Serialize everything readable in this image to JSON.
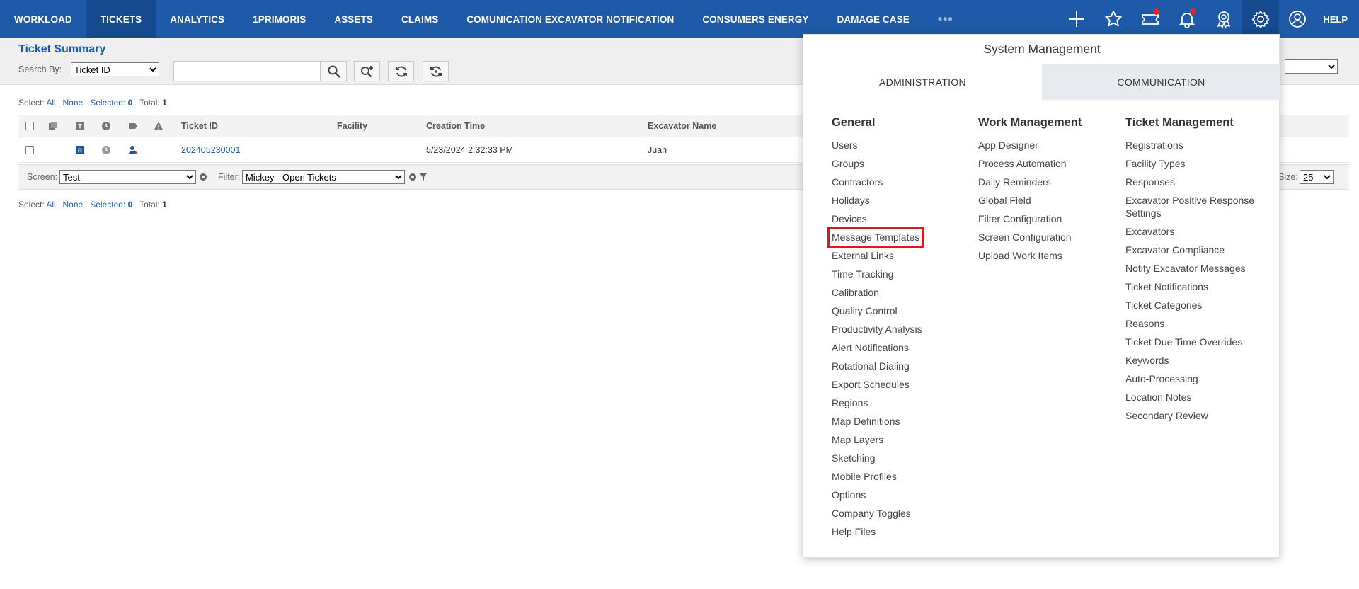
{
  "nav": {
    "items": [
      {
        "label": "WORKLOAD",
        "active": false
      },
      {
        "label": "TICKETS",
        "active": true
      },
      {
        "label": "ANALYTICS",
        "active": false
      },
      {
        "label": "1PRIMORIS",
        "active": false
      },
      {
        "label": "ASSETS",
        "active": false
      },
      {
        "label": "CLAIMS",
        "active": false
      },
      {
        "label": "COMUNICATION EXCAVATOR NOTIFICATION",
        "active": false
      },
      {
        "label": "CONSUMERS ENERGY",
        "active": false
      },
      {
        "label": "DAMAGE CASE",
        "active": false
      }
    ],
    "more": "•••",
    "icons": [
      "plus-icon",
      "star-icon",
      "ticket-icon",
      "bell-icon",
      "award-icon",
      "gear-icon",
      "user-icon"
    ],
    "help": "HELP",
    "bg_color": "#1e5aa8",
    "active_color": "#154a8f"
  },
  "header": {
    "title": "Ticket Summary",
    "search_by_label": "Search By:",
    "search_by_value": "Ticket ID",
    "search_value": ""
  },
  "selection_top": {
    "select": "Select:",
    "all": "All",
    "sep": "|",
    "none": "None",
    "selected_label": "Selected:",
    "selected": "0",
    "total_label": "Total:",
    "total": "1"
  },
  "selection_bottom": {
    "select": "Select:",
    "all": "All",
    "sep": "|",
    "none": "None",
    "selected_label": "Selected:",
    "selected": "0",
    "total_label": "Total:",
    "total": "1"
  },
  "grid": {
    "columns": [
      "Ticket ID",
      "Facility",
      "Creation Time",
      "Excavator Name"
    ],
    "row": {
      "ticket_id": "202405230001",
      "facility": "",
      "creation_time": "5/23/2024 2:32:33 PM",
      "excavator": "Juan",
      "type_badge": "R"
    },
    "footer": {
      "screen_label": "Screen:",
      "screen_value": "Test",
      "filter_label": "Filter:",
      "filter_value": "Mickey - Open Tickets",
      "size_label": "Size:",
      "size_value": "25"
    }
  },
  "system_management": {
    "title": "System Management",
    "tabs": [
      "ADMINISTRATION",
      "COMMUNICATION"
    ],
    "general": {
      "heading": "General",
      "items": [
        "Users",
        "Groups",
        "Contractors",
        "Holidays",
        "Devices",
        "Message Templates",
        "External Links",
        "Time Tracking",
        "Calibration",
        "Quality Control",
        "Productivity Analysis",
        "Alert Notifications",
        "Rotational Dialing",
        "Export Schedules",
        "Regions",
        "Map Definitions",
        "Map Layers",
        "Sketching",
        "Mobile Profiles",
        "Options",
        "Company Toggles",
        "Help Files"
      ]
    },
    "work_management": {
      "heading": "Work Management",
      "items": [
        "App Designer",
        "Process Automation",
        "Daily Reminders",
        "Global Field",
        "Filter Configuration",
        "Screen Configuration",
        "Upload Work Items"
      ]
    },
    "ticket_management": {
      "heading": "Ticket Management",
      "items": [
        "Registrations",
        "Facility Types",
        "Responses",
        "Excavator Positive Response Settings",
        "Excavators",
        "Excavator Compliance",
        "Notify Excavator Messages",
        "Ticket Notifications",
        "Ticket Categories",
        "Reasons",
        "Ticket Due Time Overrides",
        "Keywords",
        "Auto-Processing",
        "Location Notes",
        "Secondary Review"
      ]
    },
    "highlighted_item": "Message Templates"
  }
}
